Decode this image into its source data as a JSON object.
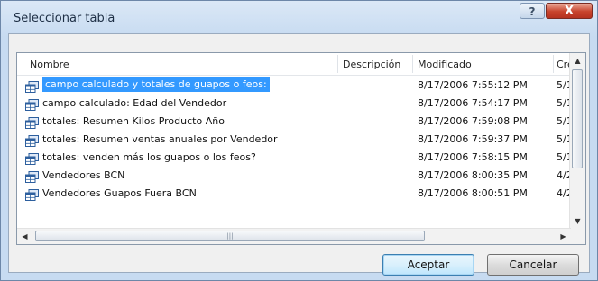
{
  "window": {
    "title": "Seleccionar tabla",
    "help_label": "?",
    "close_label": "X"
  },
  "columns": {
    "name": "Nombre",
    "description": "Descripción",
    "modified": "Modificado",
    "created": "Cre"
  },
  "rows": [
    {
      "name": "campo calculado y totales de guapos o feos:",
      "modified": "8/17/2006 7:55:12 PM",
      "created": "5/1",
      "selected": true
    },
    {
      "name": "campo calculado: Edad del Vendedor",
      "modified": "8/17/2006 7:54:17 PM",
      "created": "5/1",
      "selected": false
    },
    {
      "name": "totales: Resumen Kilos Producto Año",
      "modified": "8/17/2006 7:59:08 PM",
      "created": "5/1",
      "selected": false
    },
    {
      "name": "totales: Resumen ventas anuales por Vendedor",
      "modified": "8/17/2006 7:59:37 PM",
      "created": "5/1",
      "selected": false
    },
    {
      "name": "totales: venden más los guapos o los feos?",
      "modified": "8/17/2006 7:58:15 PM",
      "created": "5/1",
      "selected": false
    },
    {
      "name": "Vendedores BCN",
      "modified": "8/17/2006 8:00:35 PM",
      "created": "4/2",
      "selected": false
    },
    {
      "name": "Vendedores Guapos Fuera BCN",
      "modified": "8/17/2006 8:00:51 PM",
      "created": "4/2",
      "selected": false
    }
  ],
  "buttons": {
    "accept": "Aceptar",
    "cancel": "Cancelar"
  },
  "icons": {
    "table": "table-icon",
    "scroll_up": "scroll-up-arrow-icon",
    "scroll_down": "scroll-down-arrow-icon",
    "scroll_left": "scroll-left-arrow-icon",
    "scroll_right": "scroll-right-arrow-icon"
  },
  "colors": {
    "selection": "#3399ff",
    "close_button": "#c8432c",
    "icon_blue": "#2d5f9e"
  }
}
